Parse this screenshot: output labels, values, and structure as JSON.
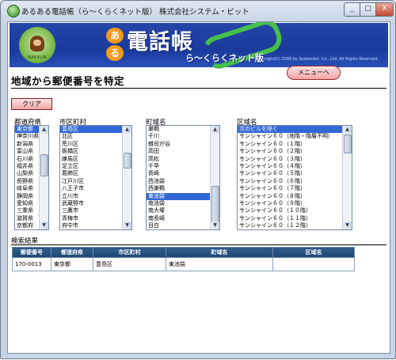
{
  "window": {
    "title": "あるある電話帳（ら～くらくネット版） 株式会社システム・ビット",
    "controls": {
      "minimize": "_",
      "maximize": "□",
      "close": "X"
    }
  },
  "banner": {
    "mascot_caption": "RAKKUN",
    "logo_chars": [
      "あ",
      "る"
    ],
    "logo_main": "電話帳",
    "logo_sub": "ら～くらくネット版",
    "copyright": "Copyright(C) 2009 by Systembit. Co., Ltd. All Rights Reserved."
  },
  "page": {
    "title": "地域から郵便番号を特定",
    "menu_button": "メニューへ",
    "clear_button": "クリア"
  },
  "lists": {
    "prefecture": {
      "label": "都道府県",
      "selected_index": 0,
      "items": [
        "東京都",
        "神奈川県",
        "新潟県",
        "富山県",
        "石川県",
        "福井県",
        "山梨県",
        "長野県",
        "岐阜県",
        "静岡県",
        "愛知県",
        "三重県",
        "滋賀県",
        "京都府"
      ]
    },
    "city": {
      "label": "市区町村",
      "selected_index": 0,
      "items": [
        "豊島区",
        "北区",
        "荒川区",
        "板橋区",
        "練馬区",
        "足立区",
        "葛飾区",
        "江戸川区",
        "八王子市",
        "立川市",
        "武蔵野市",
        "三鷹市",
        "青梅市",
        "府中市"
      ]
    },
    "town": {
      "label": "町域名",
      "selected_index": 9,
      "items": [
        "巣鴨",
        "千川",
        "雑司が谷",
        "高田",
        "高松",
        "千早",
        "長崎",
        "西池袋",
        "西巣鴨",
        "東池袋",
        "南池袋",
        "南大塚",
        "南長崎",
        "目白"
      ]
    },
    "area": {
      "label": "区域名",
      "selected_index": 0,
      "items": [
        "次のビルを除く",
        "サンシャイン６０（地階・階層不明）",
        "サンシャイン６０（１階）",
        "サンシャイン６０（２階）",
        "サンシャイン６０（３階）",
        "サンシャイン６０（４階）",
        "サンシャイン６０（５階）",
        "サンシャイン６０（６階）",
        "サンシャイン６０（７階）",
        "サンシャイン６０（８階）",
        "サンシャイン６０（９階）",
        "サンシャイン６０（１０階）",
        "サンシャイン６０（１１階）",
        "サンシャイン６０（１２階）"
      ]
    }
  },
  "results": {
    "title": "検索結果",
    "headers": [
      "郵便番号",
      "都道府県",
      "市区町村",
      "町域名",
      "区域名"
    ],
    "rows": [
      [
        "170-0013",
        "東京都",
        "豊島区",
        "東池袋",
        ""
      ]
    ]
  },
  "colors": {
    "selection": "#3168d6",
    "banner": "#1a3a9c",
    "button_pink": "#f3a6a6",
    "table_header": "#1d4572"
  }
}
